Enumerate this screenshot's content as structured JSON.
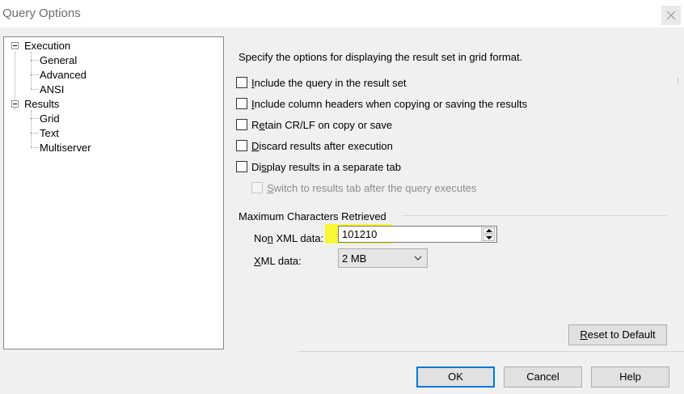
{
  "window": {
    "title": "Query Options"
  },
  "tree": {
    "execution": {
      "label": "Execution",
      "children": [
        "General",
        "Advanced",
        "ANSI"
      ]
    },
    "results": {
      "label": "Results",
      "children": [
        "Grid",
        "Text",
        "Multiserver"
      ]
    }
  },
  "panel": {
    "description": "Specify the options for displaying the result set in grid format.",
    "options": [
      {
        "pre": "",
        "key": "I",
        "post": "nclude the query in the result set",
        "checked": false,
        "enabled": true
      },
      {
        "pre": "",
        "key": "I",
        "post": "nclude column headers when copying or saving the results",
        "checked": false,
        "enabled": true
      },
      {
        "pre": "R",
        "key": "e",
        "post": "tain CR/LF on copy or save",
        "checked": false,
        "enabled": true
      },
      {
        "pre": "",
        "key": "D",
        "post": "iscard results after execution",
        "checked": false,
        "enabled": true
      },
      {
        "pre": "Di",
        "key": "s",
        "post": "play results in a separate tab",
        "checked": false,
        "enabled": true
      },
      {
        "pre": "",
        "key": "S",
        "post": "witch to results tab after the query executes",
        "checked": false,
        "enabled": false
      }
    ],
    "max_chars": {
      "group_label": "Maximum Characters Retrieved",
      "non_xml_pre": "No",
      "non_xml_key": "n",
      "non_xml_post": " XML data:",
      "non_xml_value": "101210",
      "xml_pre": "",
      "xml_key": "X",
      "xml_post": "ML data:",
      "xml_value": "2 MB"
    },
    "reset_pre": "",
    "reset_key": "R",
    "reset_post": "eset to Default"
  },
  "footer": {
    "ok": "OK",
    "cancel": "Cancel",
    "help": "Help"
  },
  "colors": {
    "highlight": "#f7f734",
    "default_button_border": "#0078d7"
  }
}
